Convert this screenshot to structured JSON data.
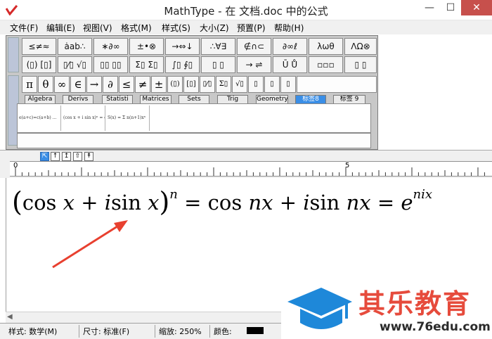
{
  "window": {
    "title": "MathType - 在 文档.doc 中的公式",
    "min_glyph": "—",
    "max_glyph": "☐",
    "close_glyph": "✕"
  },
  "menu": [
    "文件(F)",
    "编辑(E)",
    "视图(V)",
    "格式(M)",
    "样式(S)",
    "大小(Z)",
    "预置(P)",
    "帮助(H)"
  ],
  "palette_row1": [
    "≤≠≈",
    "ȧab∴",
    "∗∂∞",
    "±•⊗",
    "→⇔↓",
    "∴∀∃",
    "∉∩⊂",
    "∂∞ℓ",
    "λωθ",
    "ΛΩ⊗"
  ],
  "palette_row2": [
    "(▯) [▯]",
    "▯⁄▯ √▯",
    "▯▯ ▯▯",
    "Σ▯ Σ▯",
    "∫▯ ∮▯",
    "▯ ▯",
    "→ ⇌",
    "Ū Ů",
    "▫▫▫",
    "▯ ▯"
  ],
  "symbol_row": [
    "π",
    "θ",
    "∞",
    "∈",
    "→",
    "∂",
    "≤",
    "≠",
    "±",
    "(▯)",
    "[▯]",
    "▯⁄▯",
    "Σ▯",
    "√▯",
    "▯",
    "▯",
    "▯"
  ],
  "tabs": [
    "Algebra",
    "Derivs",
    "Statisti",
    "Matrices",
    "Sets",
    "Trig",
    "Geometry",
    "标签8",
    "标签 9"
  ],
  "active_tab": "标签8",
  "templates": [
    "e(a+c)=c(a+b) ...",
    "(cos x + i sin x)ⁿ = cos ...",
    "S(x) = Σ n(n+1)xⁿ"
  ],
  "nudge": [
    "⇱",
    "↑",
    "↥",
    "⇧",
    "↟"
  ],
  "ruler": {
    "mark0": "0",
    "mark5": "5"
  },
  "formula": {
    "lparen": "(",
    "cos1": "cos",
    "x1": "x",
    "plus1": "+",
    "i1": "i",
    "sin1": "sin",
    "x2": "x",
    "rparen": ")",
    "sup_n": "n",
    "eq1": "=",
    "cos2": "cos",
    "nx1": "nx",
    "plus2": "+",
    "i2": "i",
    "sin2": "sin",
    "nx2": "nx",
    "eq2": "=",
    "e": "e",
    "sup_nix": "nix"
  },
  "scroll_left": "◀",
  "status": {
    "style": "样式: 数学(M)",
    "size": "尺寸: 标准(F)",
    "zoom": "缩放: 250%",
    "color": "颜色:"
  },
  "watermark": {
    "brand": "其乐教育",
    "url": "www.76edu.com"
  },
  "colors": {
    "accent_blue": "#3a8ee6",
    "close_red": "#c7504c",
    "arrow_red": "#e8402f",
    "watermark_blue": "#1e88d9",
    "watermark_red": "#e64b3c"
  }
}
